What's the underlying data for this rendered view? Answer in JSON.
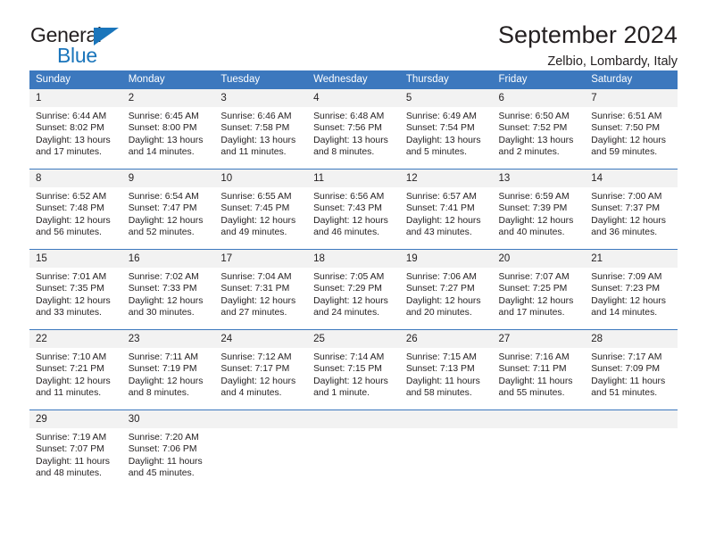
{
  "brand": {
    "name_top": "General",
    "name_bottom": "Blue"
  },
  "header": {
    "title": "September 2024",
    "subtitle": "Zelbio, Lombardy, Italy"
  },
  "colors": {
    "header_blue": "#3c78be",
    "brand_blue": "#1a75bb",
    "daynum_band": "#f2f2f2",
    "text": "#231f20"
  },
  "weekdays": [
    "Sunday",
    "Monday",
    "Tuesday",
    "Wednesday",
    "Thursday",
    "Friday",
    "Saturday"
  ],
  "weeks": [
    [
      {
        "day": "1",
        "sunrise": "Sunrise: 6:44 AM",
        "sunset": "Sunset: 8:02 PM",
        "daylight1": "Daylight: 13 hours",
        "daylight2": "and 17 minutes."
      },
      {
        "day": "2",
        "sunrise": "Sunrise: 6:45 AM",
        "sunset": "Sunset: 8:00 PM",
        "daylight1": "Daylight: 13 hours",
        "daylight2": "and 14 minutes."
      },
      {
        "day": "3",
        "sunrise": "Sunrise: 6:46 AM",
        "sunset": "Sunset: 7:58 PM",
        "daylight1": "Daylight: 13 hours",
        "daylight2": "and 11 minutes."
      },
      {
        "day": "4",
        "sunrise": "Sunrise: 6:48 AM",
        "sunset": "Sunset: 7:56 PM",
        "daylight1": "Daylight: 13 hours",
        "daylight2": "and 8 minutes."
      },
      {
        "day": "5",
        "sunrise": "Sunrise: 6:49 AM",
        "sunset": "Sunset: 7:54 PM",
        "daylight1": "Daylight: 13 hours",
        "daylight2": "and 5 minutes."
      },
      {
        "day": "6",
        "sunrise": "Sunrise: 6:50 AM",
        "sunset": "Sunset: 7:52 PM",
        "daylight1": "Daylight: 13 hours",
        "daylight2": "and 2 minutes."
      },
      {
        "day": "7",
        "sunrise": "Sunrise: 6:51 AM",
        "sunset": "Sunset: 7:50 PM",
        "daylight1": "Daylight: 12 hours",
        "daylight2": "and 59 minutes."
      }
    ],
    [
      {
        "day": "8",
        "sunrise": "Sunrise: 6:52 AM",
        "sunset": "Sunset: 7:48 PM",
        "daylight1": "Daylight: 12 hours",
        "daylight2": "and 56 minutes."
      },
      {
        "day": "9",
        "sunrise": "Sunrise: 6:54 AM",
        "sunset": "Sunset: 7:47 PM",
        "daylight1": "Daylight: 12 hours",
        "daylight2": "and 52 minutes."
      },
      {
        "day": "10",
        "sunrise": "Sunrise: 6:55 AM",
        "sunset": "Sunset: 7:45 PM",
        "daylight1": "Daylight: 12 hours",
        "daylight2": "and 49 minutes."
      },
      {
        "day": "11",
        "sunrise": "Sunrise: 6:56 AM",
        "sunset": "Sunset: 7:43 PM",
        "daylight1": "Daylight: 12 hours",
        "daylight2": "and 46 minutes."
      },
      {
        "day": "12",
        "sunrise": "Sunrise: 6:57 AM",
        "sunset": "Sunset: 7:41 PM",
        "daylight1": "Daylight: 12 hours",
        "daylight2": "and 43 minutes."
      },
      {
        "day": "13",
        "sunrise": "Sunrise: 6:59 AM",
        "sunset": "Sunset: 7:39 PM",
        "daylight1": "Daylight: 12 hours",
        "daylight2": "and 40 minutes."
      },
      {
        "day": "14",
        "sunrise": "Sunrise: 7:00 AM",
        "sunset": "Sunset: 7:37 PM",
        "daylight1": "Daylight: 12 hours",
        "daylight2": "and 36 minutes."
      }
    ],
    [
      {
        "day": "15",
        "sunrise": "Sunrise: 7:01 AM",
        "sunset": "Sunset: 7:35 PM",
        "daylight1": "Daylight: 12 hours",
        "daylight2": "and 33 minutes."
      },
      {
        "day": "16",
        "sunrise": "Sunrise: 7:02 AM",
        "sunset": "Sunset: 7:33 PM",
        "daylight1": "Daylight: 12 hours",
        "daylight2": "and 30 minutes."
      },
      {
        "day": "17",
        "sunrise": "Sunrise: 7:04 AM",
        "sunset": "Sunset: 7:31 PM",
        "daylight1": "Daylight: 12 hours",
        "daylight2": "and 27 minutes."
      },
      {
        "day": "18",
        "sunrise": "Sunrise: 7:05 AM",
        "sunset": "Sunset: 7:29 PM",
        "daylight1": "Daylight: 12 hours",
        "daylight2": "and 24 minutes."
      },
      {
        "day": "19",
        "sunrise": "Sunrise: 7:06 AM",
        "sunset": "Sunset: 7:27 PM",
        "daylight1": "Daylight: 12 hours",
        "daylight2": "and 20 minutes."
      },
      {
        "day": "20",
        "sunrise": "Sunrise: 7:07 AM",
        "sunset": "Sunset: 7:25 PM",
        "daylight1": "Daylight: 12 hours",
        "daylight2": "and 17 minutes."
      },
      {
        "day": "21",
        "sunrise": "Sunrise: 7:09 AM",
        "sunset": "Sunset: 7:23 PM",
        "daylight1": "Daylight: 12 hours",
        "daylight2": "and 14 minutes."
      }
    ],
    [
      {
        "day": "22",
        "sunrise": "Sunrise: 7:10 AM",
        "sunset": "Sunset: 7:21 PM",
        "daylight1": "Daylight: 12 hours",
        "daylight2": "and 11 minutes."
      },
      {
        "day": "23",
        "sunrise": "Sunrise: 7:11 AM",
        "sunset": "Sunset: 7:19 PM",
        "daylight1": "Daylight: 12 hours",
        "daylight2": "and 8 minutes."
      },
      {
        "day": "24",
        "sunrise": "Sunrise: 7:12 AM",
        "sunset": "Sunset: 7:17 PM",
        "daylight1": "Daylight: 12 hours",
        "daylight2": "and 4 minutes."
      },
      {
        "day": "25",
        "sunrise": "Sunrise: 7:14 AM",
        "sunset": "Sunset: 7:15 PM",
        "daylight1": "Daylight: 12 hours",
        "daylight2": "and 1 minute."
      },
      {
        "day": "26",
        "sunrise": "Sunrise: 7:15 AM",
        "sunset": "Sunset: 7:13 PM",
        "daylight1": "Daylight: 11 hours",
        "daylight2": "and 58 minutes."
      },
      {
        "day": "27",
        "sunrise": "Sunrise: 7:16 AM",
        "sunset": "Sunset: 7:11 PM",
        "daylight1": "Daylight: 11 hours",
        "daylight2": "and 55 minutes."
      },
      {
        "day": "28",
        "sunrise": "Sunrise: 7:17 AM",
        "sunset": "Sunset: 7:09 PM",
        "daylight1": "Daylight: 11 hours",
        "daylight2": "and 51 minutes."
      }
    ],
    [
      {
        "day": "29",
        "sunrise": "Sunrise: 7:19 AM",
        "sunset": "Sunset: 7:07 PM",
        "daylight1": "Daylight: 11 hours",
        "daylight2": "and 48 minutes."
      },
      {
        "day": "30",
        "sunrise": "Sunrise: 7:20 AM",
        "sunset": "Sunset: 7:06 PM",
        "daylight1": "Daylight: 11 hours",
        "daylight2": "and 45 minutes."
      },
      {
        "day": "",
        "sunrise": "",
        "sunset": "",
        "daylight1": "",
        "daylight2": ""
      },
      {
        "day": "",
        "sunrise": "",
        "sunset": "",
        "daylight1": "",
        "daylight2": ""
      },
      {
        "day": "",
        "sunrise": "",
        "sunset": "",
        "daylight1": "",
        "daylight2": ""
      },
      {
        "day": "",
        "sunrise": "",
        "sunset": "",
        "daylight1": "",
        "daylight2": ""
      },
      {
        "day": "",
        "sunrise": "",
        "sunset": "",
        "daylight1": "",
        "daylight2": ""
      }
    ]
  ]
}
